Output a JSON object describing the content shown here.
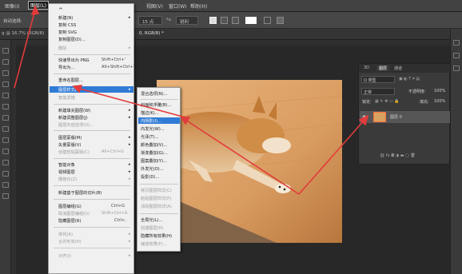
{
  "menubar": {
    "items": [
      "图像(I)",
      "图层(L)",
      "视图(V)",
      "窗口(W)",
      "帮助(H)"
    ]
  },
  "options_bar": {
    "auto_select": "自动选择:",
    "size_value": "15 点",
    "aa_value": "锐利"
  },
  "doc_tabs": {
    "tab1": "g @ 16.7% (RGB/8)",
    "tab2": "0, RGB/8) *"
  },
  "layer_menu": {
    "items": [
      {
        "label": "新建(N)",
        "shortcut": "",
        "submenu": true,
        "disabled": false
      },
      {
        "label": "复制 CSS",
        "shortcut": "",
        "submenu": false,
        "disabled": false
      },
      {
        "label": "复制 SVG",
        "shortcut": "",
        "submenu": false,
        "disabled": false
      },
      {
        "label": "复制图层(D)...",
        "shortcut": "",
        "submenu": false,
        "disabled": false
      },
      {
        "label": "删除",
        "shortcut": "",
        "submenu": true,
        "disabled": true
      },
      {
        "label": "快速导出为 PNG",
        "shortcut": "Shift+Ctrl+'",
        "submenu": false,
        "disabled": false
      },
      {
        "label": "导出为...",
        "shortcut": "Alt+Shift+Ctrl+'",
        "submenu": false,
        "disabled": false
      },
      {
        "label": "重命名图层...",
        "shortcut": "",
        "submenu": false,
        "disabled": false
      },
      {
        "label": "图层样式(Y)",
        "shortcut": "",
        "submenu": true,
        "disabled": false,
        "highlighted": true
      },
      {
        "label": "智能滤镜",
        "shortcut": "",
        "submenu": false,
        "disabled": true
      },
      {
        "label": "新建填充图层(W)",
        "shortcut": "",
        "submenu": true,
        "disabled": false
      },
      {
        "label": "新建调整图层(J)",
        "shortcut": "",
        "submenu": true,
        "disabled": false
      },
      {
        "label": "图层内容选项(O)...",
        "shortcut": "",
        "submenu": false,
        "disabled": true
      },
      {
        "label": "图层蒙版(M)",
        "shortcut": "",
        "submenu": true,
        "disabled": false
      },
      {
        "label": "矢量蒙版(V)",
        "shortcut": "",
        "submenu": true,
        "disabled": false
      },
      {
        "label": "创建剪贴蒙版(C)",
        "shortcut": "Alt+Ctrl+G",
        "submenu": false,
        "disabled": true
      },
      {
        "label": "智能对象",
        "shortcut": "",
        "submenu": true,
        "disabled": false
      },
      {
        "label": "视频图层",
        "shortcut": "",
        "submenu": true,
        "disabled": false
      },
      {
        "label": "栅格化(Z)",
        "shortcut": "",
        "submenu": true,
        "disabled": true
      },
      {
        "label": "新建基于图层的切片(B)",
        "shortcut": "",
        "submenu": false,
        "disabled": false
      },
      {
        "label": "图层编组(G)",
        "shortcut": "Ctrl+G",
        "submenu": false,
        "disabled": false
      },
      {
        "label": "取消图层编组(U)",
        "shortcut": "Shift+Ctrl+G",
        "submenu": false,
        "disabled": true
      },
      {
        "label": "隐藏图层(R)",
        "shortcut": "Ctrl+,",
        "submenu": false,
        "disabled": false
      },
      {
        "label": "排列(A)",
        "shortcut": "",
        "submenu": true,
        "disabled": true
      },
      {
        "label": "合并形状(H)",
        "shortcut": "",
        "submenu": true,
        "disabled": true
      },
      {
        "label": "对齐(I)",
        "shortcut": "",
        "submenu": true,
        "disabled": true
      }
    ]
  },
  "style_submenu": {
    "items": [
      {
        "label": "混合选项(N)...",
        "disabled": false
      },
      {
        "label": "斜面和浮雕(B)...",
        "disabled": false
      },
      {
        "label": "描边(K)...",
        "disabled": false
      },
      {
        "label": "内阴影(I)...",
        "disabled": false,
        "highlighted": true
      },
      {
        "label": "内发光(W)...",
        "disabled": false
      },
      {
        "label": "光泽(T)...",
        "disabled": false
      },
      {
        "label": "颜色叠加(V)...",
        "disabled": false
      },
      {
        "label": "渐变叠加(G)...",
        "disabled": false
      },
      {
        "label": "图案叠加(Y)...",
        "disabled": false
      },
      {
        "label": "外发光(O)...",
        "disabled": false
      },
      {
        "label": "投影(D)...",
        "disabled": false
      },
      {
        "label": "拷贝图层样式(C)",
        "disabled": true
      },
      {
        "label": "粘贴图层样式(P)",
        "disabled": true
      },
      {
        "label": "清除图层样式(A)",
        "disabled": true
      },
      {
        "label": "全局光(L)...",
        "disabled": false
      },
      {
        "label": "创建图层(R)",
        "disabled": true
      },
      {
        "label": "隐藏所有效果(H)",
        "disabled": false
      },
      {
        "label": "缩放效果(F)...",
        "disabled": true
      }
    ]
  },
  "layers_panel": {
    "tabs": [
      "3D",
      "图层",
      "通道"
    ],
    "kind_label": "Q 类型",
    "blend_mode": "正常",
    "opacity_label": "不透明度:",
    "opacity_value": "100%",
    "lock_label": "锁定:",
    "fill_label": "填充:",
    "fill_value": "100%",
    "layer_name": "图层 0"
  },
  "colors": {
    "accent": "#2f7bd6",
    "annotation_red": "#e23b3b"
  }
}
